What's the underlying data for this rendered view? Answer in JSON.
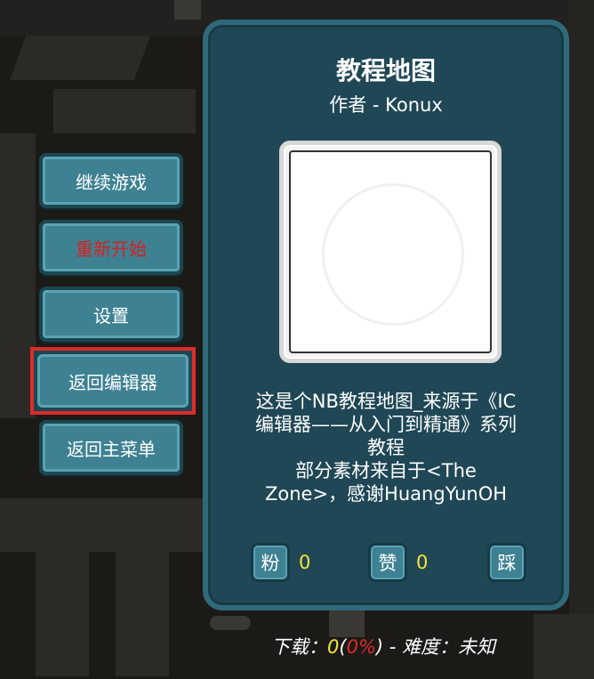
{
  "menu": {
    "continue": "继续游戏",
    "restart": "重新开始",
    "settings": "设置",
    "back_to_editor": "返回编辑器",
    "back_to_main_menu": "返回主菜单"
  },
  "level": {
    "title": "教程地图",
    "author": "作者 - Konux",
    "description_lines": [
      "这是个NB教程地图_来源于《IC",
      "编辑器——从入门到精通》系列",
      "教程",
      "部分素材来自于<The",
      "Zone>，感谢HuangYunOH"
    ],
    "fans_label": "粉",
    "fans_count": "0",
    "likes_label": "赞",
    "likes_count": "0",
    "dislike_label": "踩"
  },
  "footer": {
    "downloads_label": "下载：",
    "downloads_count": "0",
    "open_paren": "(",
    "downloads_percent": "0%",
    "close_paren": ")",
    "difficulty_label": " - 难度：未知"
  },
  "colors": {
    "button": "#3e8192",
    "panel": "#1f4755",
    "highlight": "#e02a2a",
    "stat_value": "#f3e63a"
  }
}
